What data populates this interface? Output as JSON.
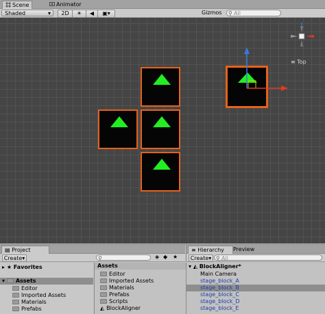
{
  "tabs": [
    {
      "label": "Scene",
      "icon": "scene-hash-icon"
    },
    {
      "label": "Animator",
      "icon": "animator-icon"
    }
  ],
  "scene_toolbar": {
    "shading_mode": "Shaded",
    "mode_2d": "2D",
    "gizmos_label": "Gizmos",
    "search_placeholder": "All"
  },
  "gizmo": {
    "view_label": "Top",
    "axis_colors": {
      "x": "#e03a1f",
      "y": "#3a78e0",
      "z": "#9a9a9a"
    }
  },
  "scene_colors": {
    "block_border": "#e8621a",
    "arrow_fill": "#22ee22",
    "background": "#454545"
  },
  "project": {
    "tab_label": "Project",
    "create_label": "Create",
    "search_placeholder": "",
    "favorites_label": "Favorites",
    "assets_label": "Assets",
    "tree": [
      "Editor",
      "Imported Assets",
      "Materials",
      "Prefabs"
    ],
    "assets_header": "Assets",
    "assets_items": [
      "Editor",
      "Imported Assets",
      "Materials",
      "Prefabs",
      "Scripts",
      "BlockAligner"
    ]
  },
  "hierarchy": {
    "tab_label": "Hierarchy",
    "preview_label": "Preview",
    "create_label": "Create",
    "search_placeholder": "All",
    "scene_name": "BlockAligner*",
    "items": [
      {
        "label": "Main Camera",
        "selected": false,
        "prefab": false
      },
      {
        "label": "stage_block_A",
        "selected": false,
        "prefab": true
      },
      {
        "label": "stage_block_B",
        "selected": true,
        "prefab": true
      },
      {
        "label": "stage_block_C",
        "selected": false,
        "prefab": true
      },
      {
        "label": "stage_block_D",
        "selected": false,
        "prefab": true
      },
      {
        "label": "stage_block_E",
        "selected": false,
        "prefab": true
      }
    ]
  }
}
